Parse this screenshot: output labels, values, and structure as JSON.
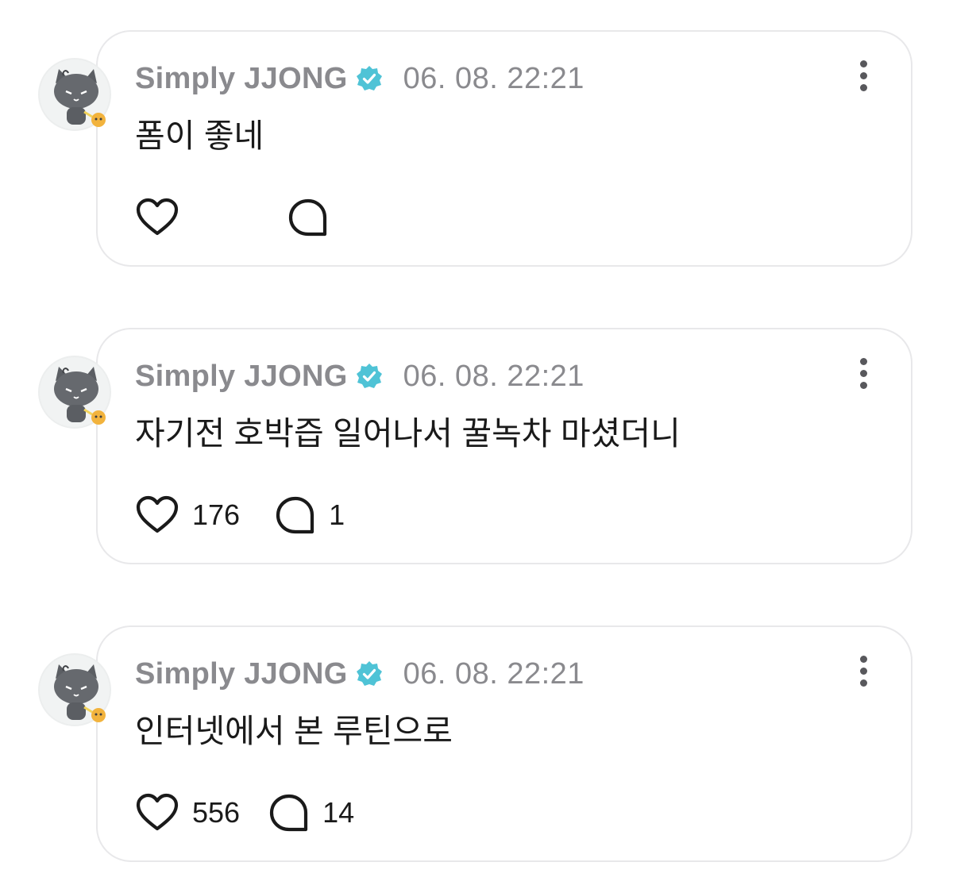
{
  "comments": [
    {
      "author": "Simply JJONG",
      "timestamp": "06. 08. 22:21",
      "text": "폼이 좋네",
      "likes": "",
      "replies": ""
    },
    {
      "author": "Simply JJONG",
      "timestamp": "06. 08. 22:21",
      "text": "자기전 호박즙 일어나서 꿀녹차 마셨더니",
      "likes": "176",
      "replies": "1"
    },
    {
      "author": "Simply JJONG",
      "timestamp": "06. 08. 22:21",
      "text": "인터넷에서 본 루틴으로",
      "likes": "556",
      "replies": "14"
    }
  ],
  "icons": {
    "verified": "verified-badge-icon",
    "like": "heart-icon",
    "reply": "speech-bubble-icon",
    "more": "more-vertical-icon"
  },
  "colors": {
    "verified": "#4fc3d6",
    "meta_text": "#8a8a8e",
    "body_text": "#1a1a1a",
    "card_border": "#e8e8ea"
  }
}
